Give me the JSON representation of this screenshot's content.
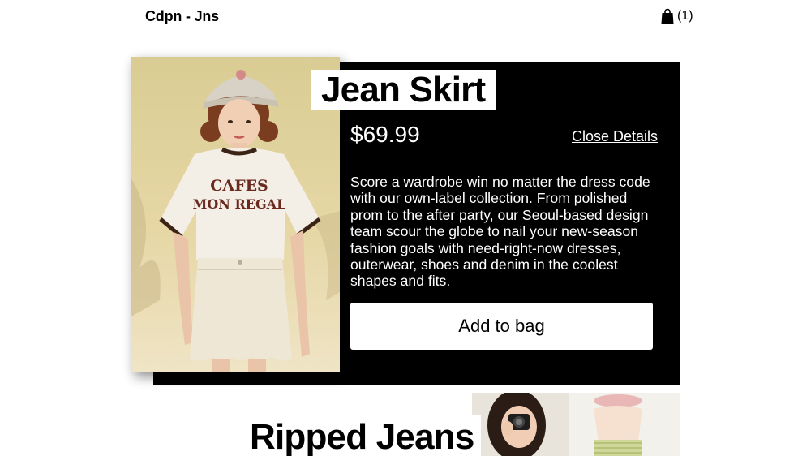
{
  "header": {
    "brand": "Cdpn - Jns",
    "bag_icon": "shopping-bag-icon",
    "bag_count": "(1)"
  },
  "product_detail": {
    "title": "Jean Skirt",
    "price": "$69.99",
    "close_label": "Close Details",
    "description": "Score a wardrobe win no matter the dress code with our own-label collection. From polished prom to the after party, our Seoul-based design team scour the globe to nail your new-season fashion goals with need-right-now dresses, outerwear, shoes and denim in the coolest shapes and fits.",
    "add_button_label": "Add to bag",
    "shirt_print_line1": "CAFES",
    "shirt_print_line2": "MON REGAL"
  },
  "next_product": {
    "title": "Ripped Jeans"
  },
  "colors": {
    "card_background": "#000000",
    "text_on_card": "#ffffff",
    "page_background": "#ffffff"
  }
}
